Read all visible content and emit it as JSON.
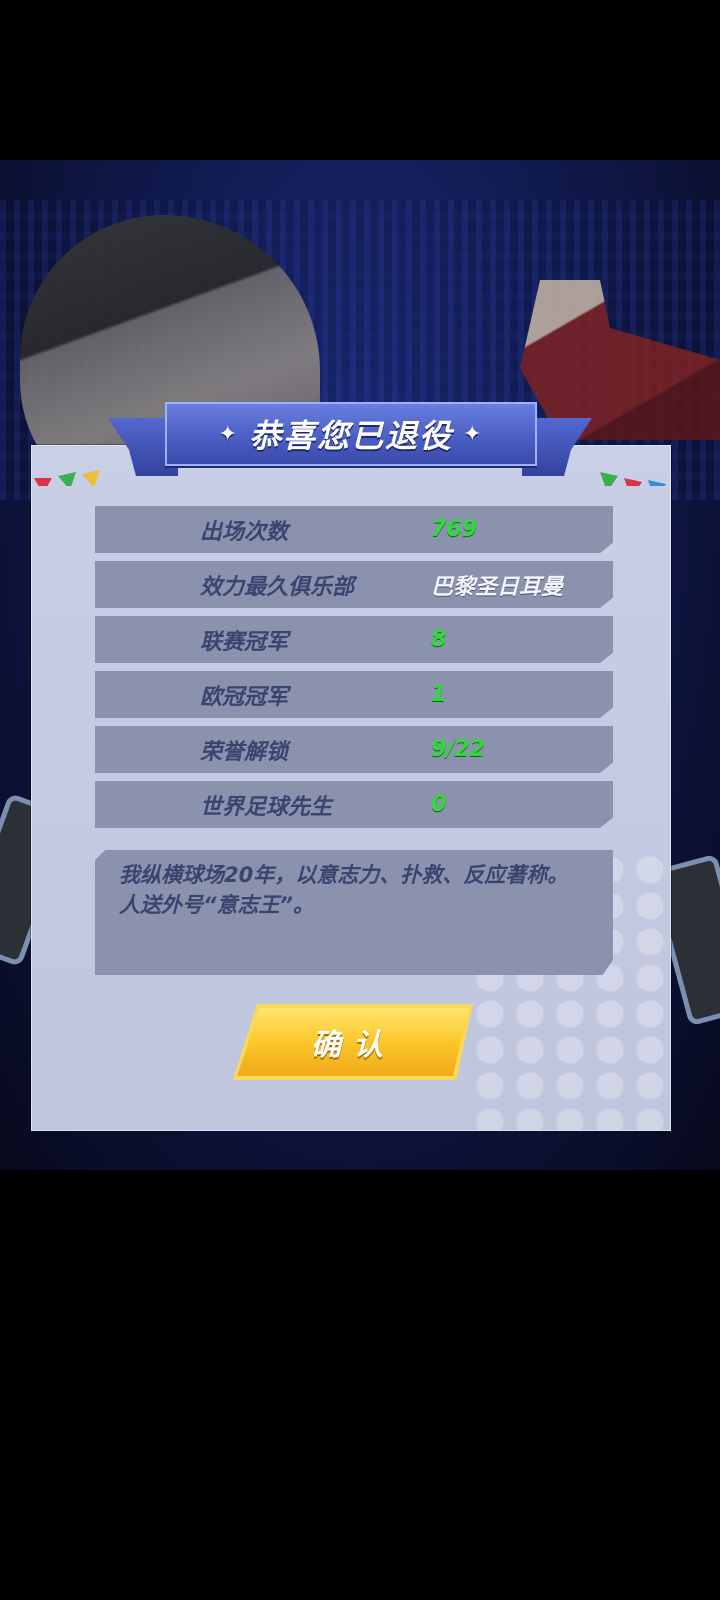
{
  "dialog": {
    "title": "恭喜您已退役",
    "star_glyph": "✦",
    "stats": [
      {
        "label": "出场次数",
        "value": "769",
        "color": "green"
      },
      {
        "label": "效力最久俱乐部",
        "value": "巴黎圣日耳曼",
        "color": "white"
      },
      {
        "label": "联赛冠军",
        "value": "8",
        "color": "green"
      },
      {
        "label": "欧冠冠军",
        "value": "1",
        "color": "green"
      },
      {
        "label": "荣誉解锁",
        "value": "9/22",
        "color": "green"
      },
      {
        "label": "世界足球先生",
        "value": "0",
        "color": "green"
      }
    ],
    "bio": "我纵横球场20年，以意志力、扑救、反应著称。人送外号“意志王”。",
    "confirm_label": "确认"
  },
  "colors": {
    "value_green": "#2edb3a",
    "label_blue": "#3b4470",
    "button_yellow": "#fbc72a",
    "banner_blue": "#4b5fc4"
  }
}
